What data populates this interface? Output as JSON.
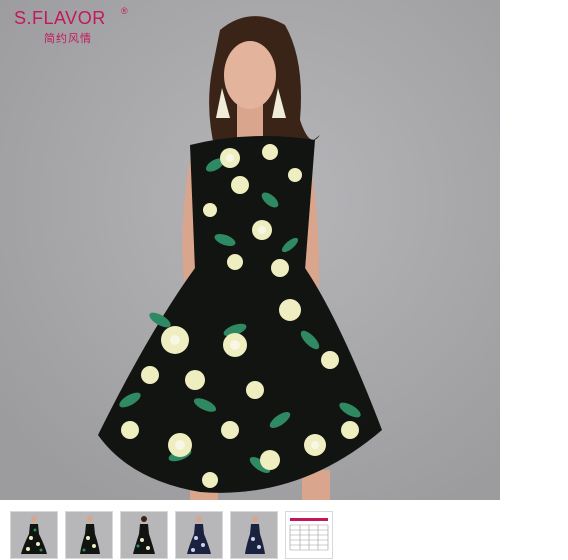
{
  "brand": {
    "name": "S.FLAVOR",
    "registered": "®",
    "subtitle": "简约风情"
  },
  "colors": {
    "brand": "#c2185b",
    "background": "#a9a9ad",
    "dress_base": "#111411",
    "flower": "#eeeec0",
    "leaf": "#2f8a63"
  },
  "thumbnails": [
    {
      "name": "thumb-green-floral-front",
      "kind": "photo"
    },
    {
      "name": "thumb-green-floral-side",
      "kind": "photo"
    },
    {
      "name": "thumb-green-floral-back",
      "kind": "photo"
    },
    {
      "name": "thumb-blue-floral-front",
      "kind": "photo"
    },
    {
      "name": "thumb-blue-floral-side",
      "kind": "photo"
    },
    {
      "name": "thumb-size-chart",
      "kind": "size-chart"
    }
  ]
}
